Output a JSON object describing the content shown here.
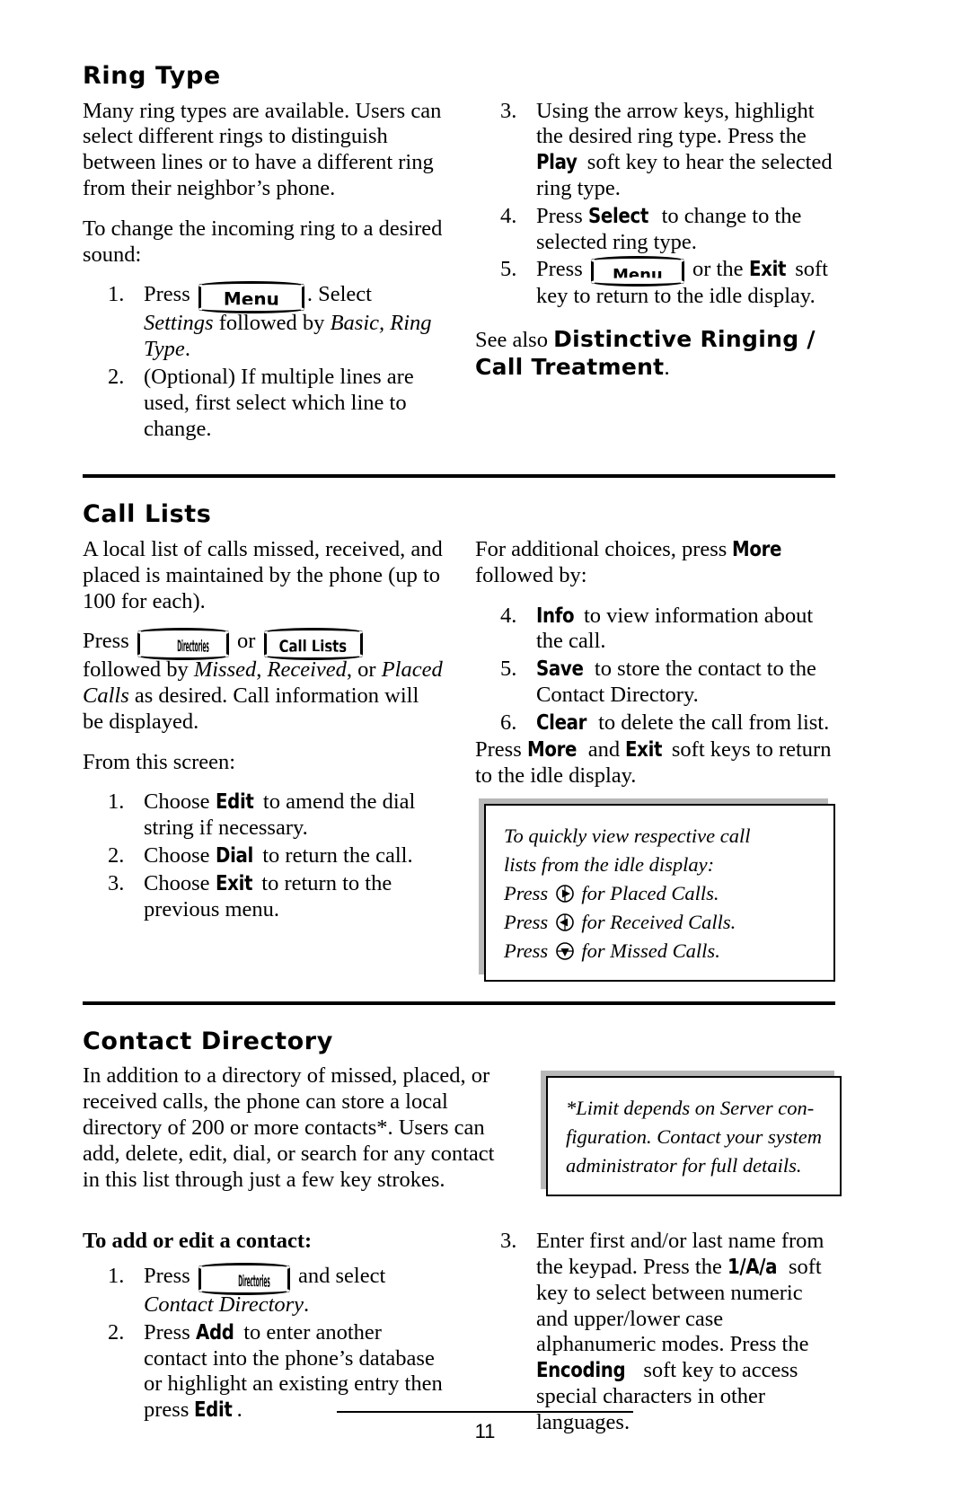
{
  "document": {
    "page_number": "11"
  },
  "sections": [
    {
      "id": "ring-type",
      "title": "Ring Type",
      "left": {
        "para1": "Many ring types are available.  Users can select different rings to distinguish between lines or to have a different ring from their neighbor’s phone.",
        "para2": "To change the incoming ring to a desired sound:",
        "steps": [
          {
            "num": "1.",
            "pre": "Press",
            "key": "Menu",
            "post_a": ".  Select ",
            "post_em": "Settings",
            "post_b": " followed by ",
            "post_em2": "Basic, Ring Type",
            "post_c": "."
          },
          {
            "num": "2.",
            "text": "(Optional)  If multiple lines are used, first select which line to change."
          }
        ]
      },
      "right": {
        "steps": [
          {
            "num": "3.",
            "pre": "Using the arrow keys, highlight the desired ring type.  Press the ",
            "soft": "Play",
            "post": " soft key to hear the selected ring type."
          },
          {
            "num": "4.",
            "pre": "Press ",
            "soft": "Select",
            "post": " to change to the selected ring type."
          },
          {
            "num": "5.",
            "pre": "Press",
            "key": "Menu",
            "mid": " or the ",
            "soft": "Exit",
            "post": " soft key to return to the idle display."
          }
        ],
        "see_also_prefix": "See also ",
        "see_also_term": "Distinctive Ringing / Call Treatment",
        "see_also_suffix": "."
      }
    },
    {
      "id": "call-lists",
      "title": "Call Lists",
      "left": {
        "para1": "A local list of calls missed, received, and placed is maintained by the phone (up to 100 for each).",
        "press_line": {
          "pre": "Press",
          "key1": "Directories",
          "mid": " or ",
          "key2": "Call Lists",
          "post_a": " followed by ",
          "em1": "Missed",
          "sep1": ", ",
          "em2": "Received",
          "sep2": ", or ",
          "em3": "Placed Calls",
          "post_b": " as desired.  Call information will be displayed."
        },
        "para3": "From this screen:",
        "steps": [
          {
            "num": "1.",
            "pre": "Choose ",
            "soft": "Edit",
            "post": " to amend the dial string if necessary."
          },
          {
            "num": "2.",
            "pre": "Choose ",
            "soft": "Dial",
            "post": " to return the call."
          },
          {
            "num": "3.",
            "pre": "Choose ",
            "soft": "Exit",
            "post": " to return to the previous menu."
          }
        ]
      },
      "right": {
        "intro_pre": "For additional choices, press ",
        "intro_soft": "More",
        "intro_post": " followed by:",
        "steps": [
          {
            "num": "4.",
            "soft": "Info",
            "post": " to view information about the call."
          },
          {
            "num": "5.",
            "soft": "Save",
            "post": " to store the contact to the Contact Directory."
          },
          {
            "num": "6.",
            "soft": "Clear",
            "post": " to delete the call from list."
          }
        ],
        "outro_pre": "Press ",
        "outro_soft1": "More",
        "outro_mid": " and ",
        "outro_soft2": "Exit",
        "outro_post": " soft keys to return to the idle display.",
        "callout": {
          "line1": "To quickly view respective call",
          "line2": "lists from the idle display:",
          "line3_pre": "Press ",
          "line3_icon": "arrow-right-circle-icon",
          "line3_post": " for Placed Calls.",
          "line4_pre": "Press ",
          "line4_icon": "arrow-left-circle-icon",
          "line4_post": " for Received Calls.",
          "line5_pre": "Press ",
          "line5_icon": "arrow-down-circle-icon",
          "line5_post": " for Missed Calls."
        }
      }
    },
    {
      "id": "contact-directory",
      "title": "Contact Directory",
      "left": {
        "para1": "In addition to a directory of missed, placed, or received calls, the phone can store a local directory of 200 or more contacts*.  Users can add, delete, edit, dial,  or search for any contact in this list through just a few key strokes.",
        "subhead": "To add or edit a contact:",
        "steps": [
          {
            "num": "1.",
            "pre": "Press",
            "key": "Directories",
            "post_a": " and select ",
            "post_em": "Contact Directory",
            "post_b": "."
          },
          {
            "num": "2.",
            "pre": "Press ",
            "soft": "Add",
            "mid": " to enter another contact into the phone’s database or highlight an existing entry then press ",
            "soft2": "Edit",
            "post": "."
          }
        ]
      },
      "right": {
        "callout": {
          "line1": "*Limit depends on Server con-",
          "line2": "figuration.  Contact your system",
          "line3": "administrator for full details."
        },
        "steps": [
          {
            "num": "3.",
            "pre": "Enter first and/or last name from the keypad.  Press the ",
            "soft": "1/A/a",
            "mid": " soft key to select between numeric and upper/lower case alphanumeric modes. Press the ",
            "soft2": "Encoding",
            "post": " soft key to access special characters in other languages."
          }
        ]
      }
    }
  ]
}
